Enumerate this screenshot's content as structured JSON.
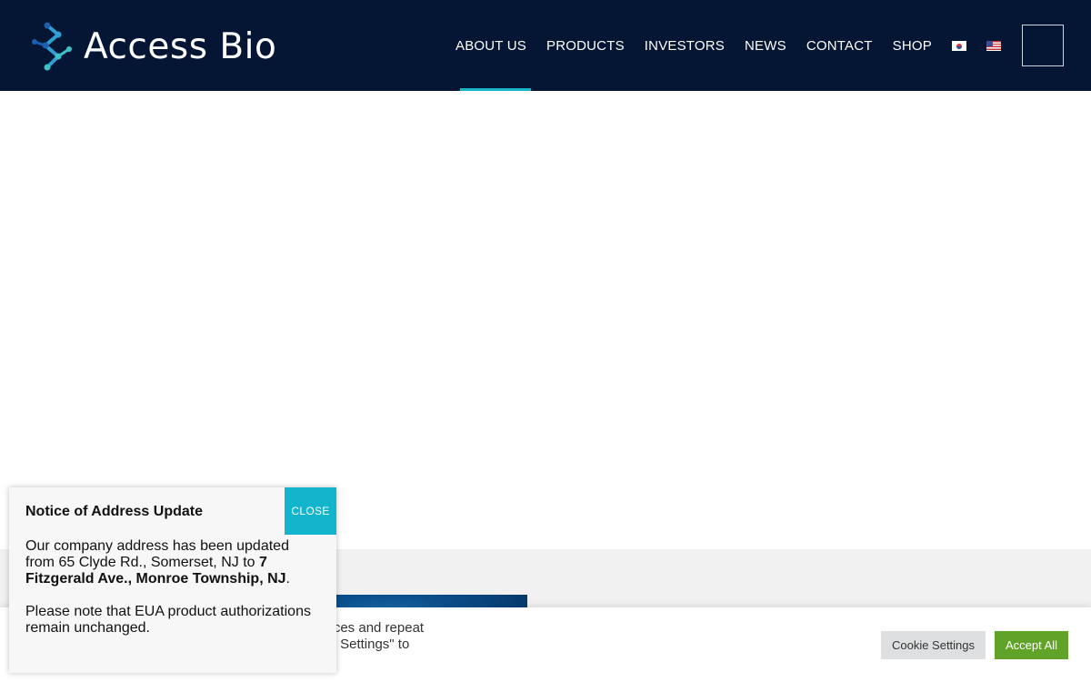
{
  "header": {
    "logo_text": "Access Bio",
    "nav": [
      {
        "label": "ABOUT US",
        "active": true
      },
      {
        "label": "PRODUCTS",
        "active": false
      },
      {
        "label": "INVESTORS",
        "active": false
      },
      {
        "label": "NEWS",
        "active": false
      },
      {
        "label": "CONTACT",
        "active": false
      },
      {
        "label": "SHOP",
        "active": false
      }
    ],
    "languages": [
      "korean-flag-icon",
      "us-flag-icon"
    ],
    "accent_color": "#19b5c8",
    "background_color": "#041633"
  },
  "notice": {
    "title": "Notice of Address Update",
    "close_label": "CLOSE",
    "body_prefix": "Our company address has been updated from 65 Clyde Rd., Somerset, NJ to ",
    "body_new_address": "7 Fitzgerald Ave., Monroe Township, NJ",
    "body_suffix": ".",
    "body_second": "Please note that EUA product authorizations remain unchanged."
  },
  "cookie": {
    "text_line1": "relevant experience by remembering your preferences and repeat",
    "text_line2": "of ALL the cookies. However, you may visit \"Cookie Settings\" to",
    "settings_label": "Cookie Settings",
    "accept_label": "Accept All",
    "accept_color": "#61a229"
  }
}
